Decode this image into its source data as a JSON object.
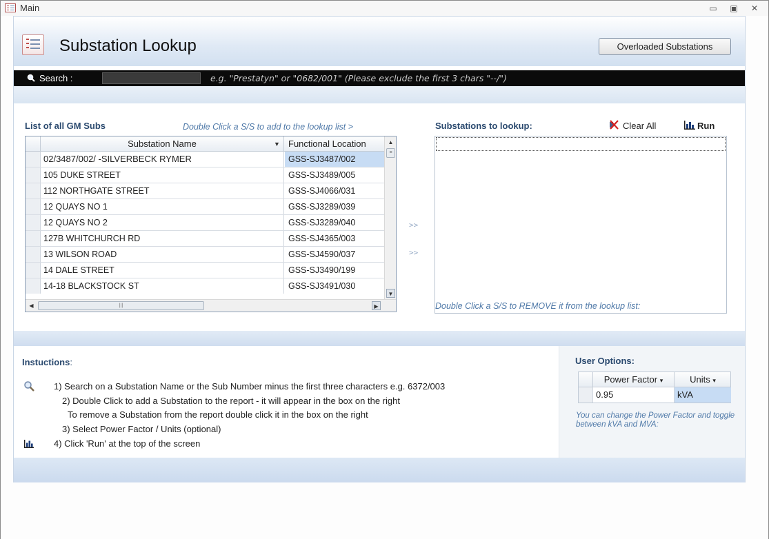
{
  "window": {
    "title": "Main",
    "minimize": "▭",
    "maximize": "▣",
    "close": "✕"
  },
  "header": {
    "title": "Substation Lookup",
    "overloaded_button": "Overloaded Substations"
  },
  "search": {
    "label": "Search :",
    "value": "",
    "hint": "e.g. \"Prestatyn\" or \"0682/001\" (Please exclude the first 3 chars \"--/\")"
  },
  "left": {
    "title": "List of all GM Subs",
    "hint": "Double Click a S/S to add to the lookup list >",
    "columns": [
      "Substation Name",
      "Functional Location"
    ],
    "rows": [
      [
        "02/3487/002/ -SILVERBECK RYMER",
        "GSS-SJ3487/002"
      ],
      [
        "105 DUKE STREET",
        "GSS-SJ3489/005"
      ],
      [
        "112 NORTHGATE STREET",
        "GSS-SJ4066/031"
      ],
      [
        "12 QUAYS NO 1",
        "GSS-SJ3289/039"
      ],
      [
        "12 QUAYS NO 2",
        "GSS-SJ3289/040"
      ],
      [
        "127B WHITCHURCH RD",
        "GSS-SJ4365/003"
      ],
      [
        "13 WILSON ROAD",
        "GSS-SJ4590/037"
      ],
      [
        "14 DALE STREET",
        "GSS-SJ3490/199"
      ],
      [
        "14-18 BLACKSTOCK ST",
        "GSS-SJ3491/030"
      ]
    ]
  },
  "arrows": [
    ">>",
    ">>"
  ],
  "right": {
    "title": "Substations to lookup:",
    "clear_label": "Clear All",
    "run_label": "Run",
    "hint": "Double Click a S/S to REMOVE it from the lookup list:"
  },
  "instructions": {
    "title": "Instuctions",
    "colon": ":",
    "lines": [
      "1) Search on a Substation Name or the Sub Number minus the first three characters e.g. 6372/003",
      "2) Double Click to add a Substation to the report - it will appear in the box on the right",
      "To remove a Substation from the report double click it in the box on the right",
      "3) Select Power Factor / Units (optional)",
      "4) Click 'Run' at the top of the screen"
    ]
  },
  "options": {
    "title": "User Options:",
    "pf_header": "Power Factor",
    "units_header": "Units",
    "pf_value": "0.95",
    "units_value": "kVA",
    "hint": "You can change the Power Factor and toggle between kVA and MVA:"
  }
}
